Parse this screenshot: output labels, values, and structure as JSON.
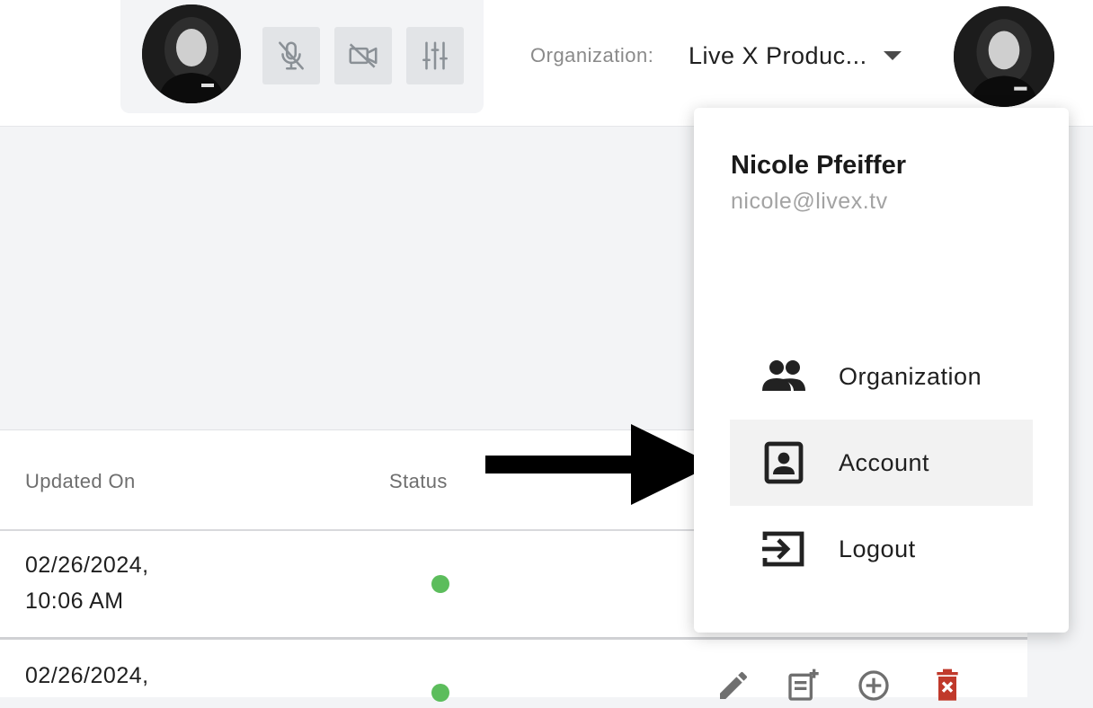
{
  "header": {
    "organization_label": "Organization:",
    "organization_value": "Live X Produc...",
    "media_controls": {
      "mic_icon": "mic-off-icon",
      "camera_icon": "camera-off-icon",
      "settings_icon": "sliders-icon"
    }
  },
  "user_menu": {
    "name": "Nicole Pfeiffer",
    "email": "nicole@livex.tv",
    "items": [
      {
        "label": "Organization",
        "icon": "people-icon"
      },
      {
        "label": "Account",
        "icon": "account-box-icon"
      },
      {
        "label": "Logout",
        "icon": "logout-icon"
      }
    ]
  },
  "table": {
    "columns": [
      "Updated On",
      "Status"
    ],
    "rows": [
      {
        "updated_on_date": "02/26/2024,",
        "updated_on_time": "10:06 AM",
        "status": "active"
      },
      {
        "updated_on_date": "02/26/2024,",
        "status": "active"
      }
    ],
    "row_action_icons": [
      "edit-icon",
      "playlist-add-icon",
      "add-circle-icon",
      "delete-icon"
    ]
  },
  "colors": {
    "status_active": "#5cbd5c",
    "delete": "#c0392b",
    "menu_active_bg": "#f2f2f2"
  }
}
